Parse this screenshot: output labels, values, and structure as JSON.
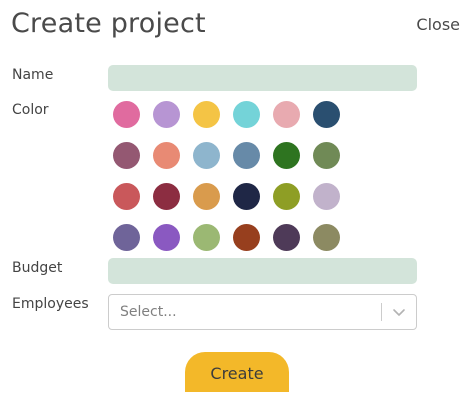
{
  "dialog": {
    "title": "Create project",
    "close_label": "Close"
  },
  "form": {
    "name_label": "Name",
    "name_value": "",
    "color_label": "Color",
    "budget_label": "Budget",
    "budget_value": "",
    "employees_label": "Employees",
    "employees_placeholder": "Select...",
    "employees_icon": "chevron-down-icon"
  },
  "colors": [
    [
      "#e06b9f",
      "#b795d3",
      "#f4c445",
      "#74d3d8",
      "#e8aab0",
      "#2a4f70"
    ],
    [
      "#945872",
      "#e88a74",
      "#8eb5cd",
      "#678aa8",
      "#2e7420",
      "#708a56"
    ],
    [
      "#c9585b",
      "#8c2d41",
      "#d99b4d",
      "#1f2746",
      "#8e9e25",
      "#c1b2cb"
    ],
    [
      "#6f6499",
      "#8a59c1",
      "#9bb873",
      "#973f1e",
      "#4e3a58",
      "#8c8a62"
    ]
  ],
  "create_button_label": "Create",
  "theme": {
    "field_bg": "#d3e4da",
    "accent": "#f3b829"
  }
}
